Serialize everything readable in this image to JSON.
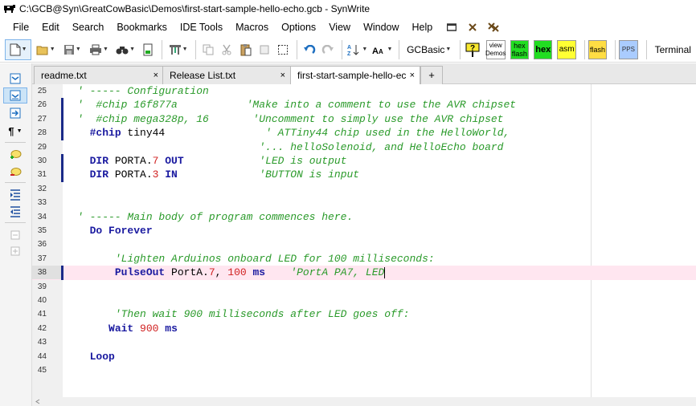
{
  "window": {
    "title": "C:\\GCB@Syn\\GreatCowBasic\\Demos\\first-start-sample-hello-echo.gcb - SynWrite"
  },
  "menu": {
    "items": [
      "File",
      "Edit",
      "Search",
      "Bookmarks",
      "IDE Tools",
      "Macros",
      "Options",
      "View",
      "Window",
      "Help"
    ]
  },
  "toolbar": {
    "language": "GCBasic",
    "view_demos_1": "view",
    "view_demos_2": "Demos",
    "hexflash_1": "hex",
    "hexflash_2": "flash",
    "hex": "hex",
    "asm": "asm",
    "flash": "flash",
    "pps": "PPS",
    "terminal": "Terminal"
  },
  "tabs": [
    {
      "label": "readme.txt",
      "close": "×"
    },
    {
      "label": "Release List.txt",
      "close": "×"
    },
    {
      "label": "first-start-sample-hello-ec",
      "close": "×"
    },
    {
      "label": "+"
    }
  ],
  "editor": {
    "lines": [
      {
        "num": "25",
        "parts": [
          [
            "com",
            "' ----- Configuration"
          ]
        ]
      },
      {
        "num": "26",
        "parts": [
          [
            "com",
            "'  #chip 16f877a           'Make into a comment to use the AVR chipset"
          ]
        ]
      },
      {
        "num": "27",
        "parts": [
          [
            "com",
            "'  #chip mega328p, 16       'Uncomment to simply use the AVR chipset"
          ]
        ]
      },
      {
        "num": "28",
        "parts": [
          [
            "txt",
            "  "
          ],
          [
            "kw",
            "#chip"
          ],
          [
            "txt",
            " tiny44                "
          ],
          [
            "com",
            "' ATTiny44 chip used in the HelloWorld,"
          ]
        ]
      },
      {
        "num": "29",
        "parts": [
          [
            "com",
            "                             '... helloSolenoid, and HelloEcho board"
          ]
        ]
      },
      {
        "num": "30",
        "parts": [
          [
            "txt",
            "  "
          ],
          [
            "kw",
            "DIR"
          ],
          [
            "txt",
            " PORTA."
          ],
          [
            "num",
            "7"
          ],
          [
            "txt",
            " "
          ],
          [
            "kw",
            "OUT"
          ],
          [
            "txt",
            "            "
          ],
          [
            "com",
            "'LED is output"
          ]
        ]
      },
      {
        "num": "31",
        "parts": [
          [
            "txt",
            "  "
          ],
          [
            "kw",
            "DIR"
          ],
          [
            "txt",
            " PORTA."
          ],
          [
            "num",
            "3"
          ],
          [
            "txt",
            " "
          ],
          [
            "kw",
            "IN"
          ],
          [
            "txt",
            "             "
          ],
          [
            "com",
            "'BUTTON is input"
          ]
        ]
      },
      {
        "num": "32",
        "parts": []
      },
      {
        "num": "33",
        "parts": []
      },
      {
        "num": "34",
        "parts": [
          [
            "com",
            "' ----- Main body of program commences here."
          ]
        ]
      },
      {
        "num": "35",
        "parts": [
          [
            "txt",
            "  "
          ],
          [
            "kw",
            "Do Forever"
          ]
        ]
      },
      {
        "num": "36",
        "parts": []
      },
      {
        "num": "37",
        "parts": [
          [
            "txt",
            "      "
          ],
          [
            "com",
            "'Lighten Arduinos onboard LED for 100 milliseconds:"
          ]
        ]
      },
      {
        "num": "38",
        "parts": [
          [
            "txt",
            "      "
          ],
          [
            "kw",
            "PulseOut"
          ],
          [
            "txt",
            " PortA."
          ],
          [
            "num",
            "7"
          ],
          [
            "txt",
            ", "
          ],
          [
            "num",
            "100"
          ],
          [
            "txt",
            " "
          ],
          [
            "kw",
            "ms"
          ],
          [
            "txt",
            "    "
          ],
          [
            "com",
            "'PortA PA7, LED"
          ]
        ]
      },
      {
        "num": "39",
        "parts": []
      },
      {
        "num": "40",
        "parts": []
      },
      {
        "num": "41",
        "parts": [
          [
            "txt",
            "      "
          ],
          [
            "com",
            "'Then wait 900 milliseconds after LED goes off:"
          ]
        ]
      },
      {
        "num": "42",
        "parts": [
          [
            "txt",
            "     "
          ],
          [
            "kw",
            "Wait"
          ],
          [
            "txt",
            " "
          ],
          [
            "num",
            "900"
          ],
          [
            "txt",
            " "
          ],
          [
            "kw",
            "ms"
          ]
        ]
      },
      {
        "num": "43",
        "parts": []
      },
      {
        "num": "44",
        "parts": [
          [
            "txt",
            "  "
          ],
          [
            "kw",
            "Loop"
          ]
        ]
      },
      {
        "num": "45",
        "parts": []
      }
    ]
  }
}
